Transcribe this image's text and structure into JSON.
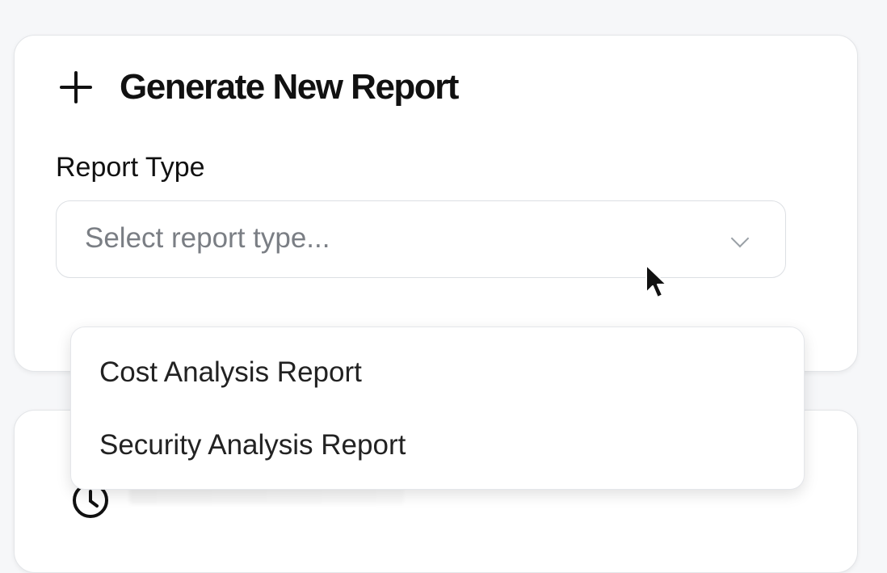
{
  "generate_card": {
    "title": "Generate New Report",
    "icon": "plus-icon"
  },
  "report_type": {
    "label": "Report Type",
    "placeholder": "Select report type...",
    "value": "",
    "options": [
      "Cost Analysis Report",
      "Security Analysis Report"
    ]
  },
  "history_card": {
    "icon": "clock-icon"
  },
  "colors": {
    "background": "#f6f7f9",
    "card": "#ffffff",
    "text": "#111111",
    "placeholder": "#7a7e84",
    "border": "#dcdfe3"
  }
}
